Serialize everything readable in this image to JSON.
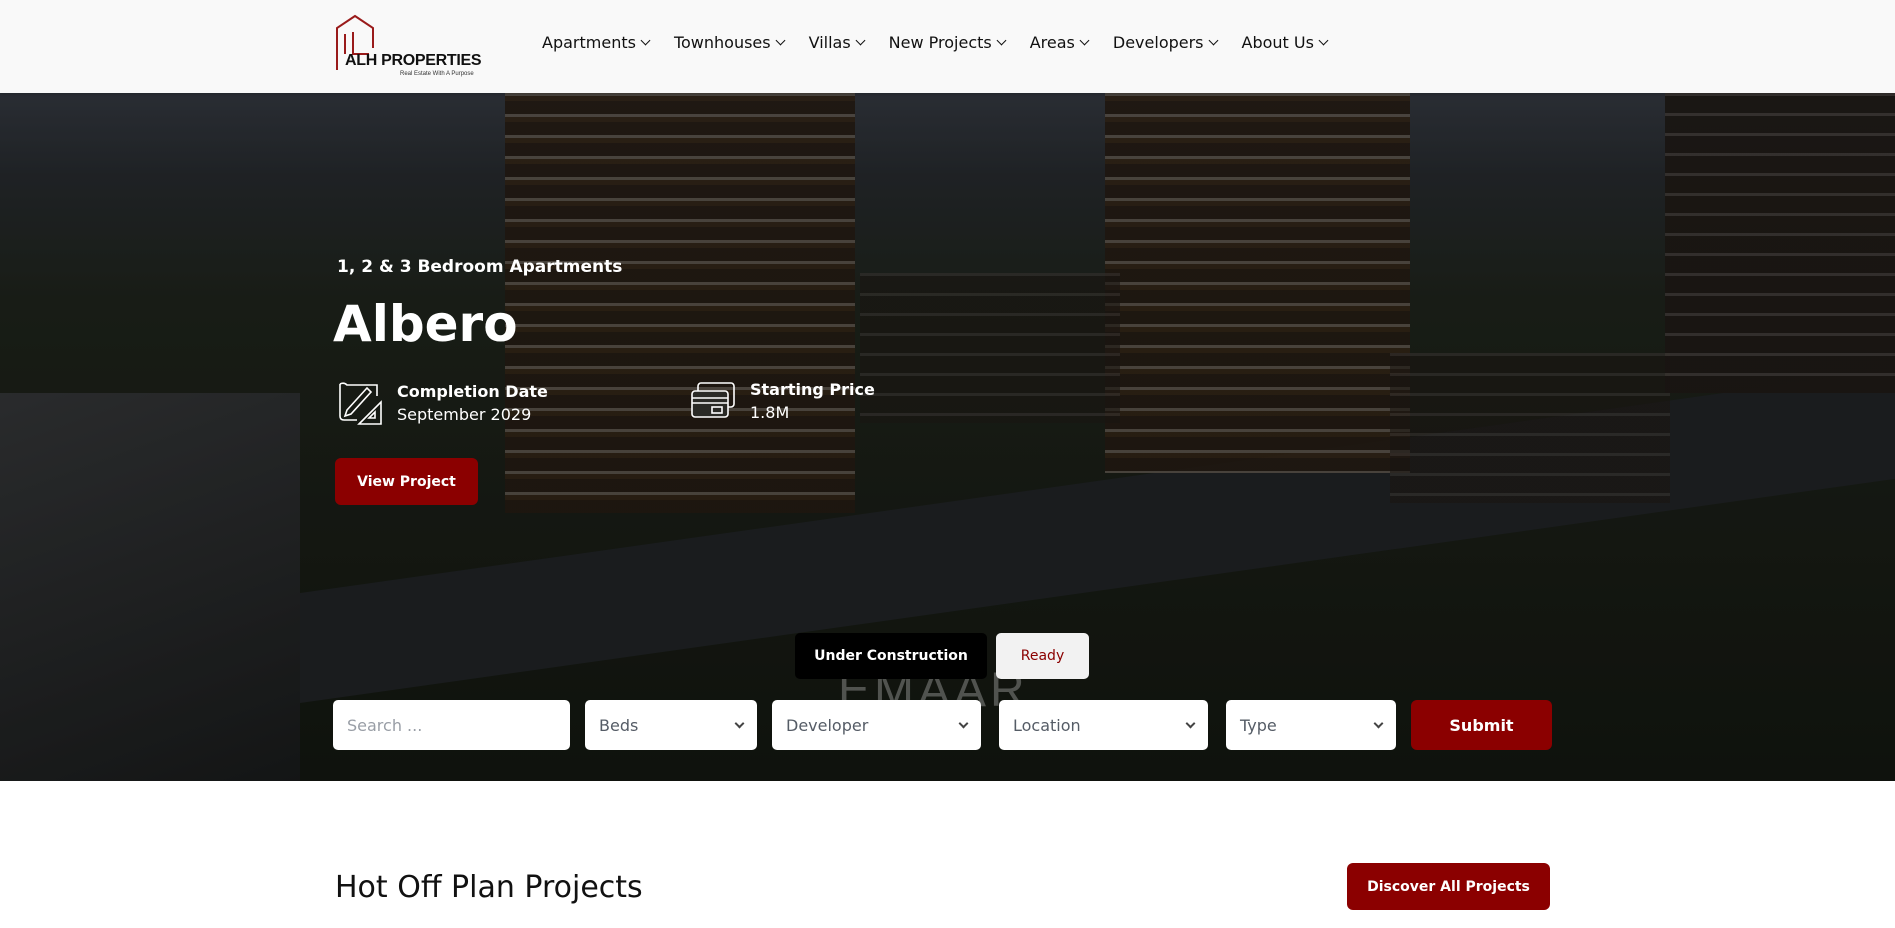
{
  "header": {
    "logo_name": "ALH PROPERTIES",
    "logo_tagline": "Real Estate With A Purpose",
    "nav": [
      {
        "label": "Apartments"
      },
      {
        "label": "Townhouses"
      },
      {
        "label": "Villas"
      },
      {
        "label": "New Projects"
      },
      {
        "label": "Areas"
      },
      {
        "label": "Developers"
      },
      {
        "label": "About Us"
      }
    ]
  },
  "hero": {
    "subtitle": "1, 2 & 3 Bedroom Apartments",
    "title": "Albero",
    "completion_label": "Completion Date",
    "completion_value": "September 2029",
    "price_label": "Starting Price",
    "price_value": "1.8M",
    "view_button": "View Project",
    "background_sign": "EMAAR"
  },
  "search": {
    "tabs": [
      {
        "label": "Under Construction",
        "active": true
      },
      {
        "label": "Ready",
        "active": false
      }
    ],
    "search_placeholder": "Search ...",
    "beds": "Beds",
    "developer": "Developer",
    "location": "Location",
    "type": "Type",
    "submit": "Submit"
  },
  "section": {
    "title": "Hot Off Plan Projects",
    "discover_button": "Discover All Projects"
  },
  "colors": {
    "accent": "#8b0000",
    "tab_active_bg": "#000000",
    "tab_inactive_bg": "#f2f2f2"
  }
}
